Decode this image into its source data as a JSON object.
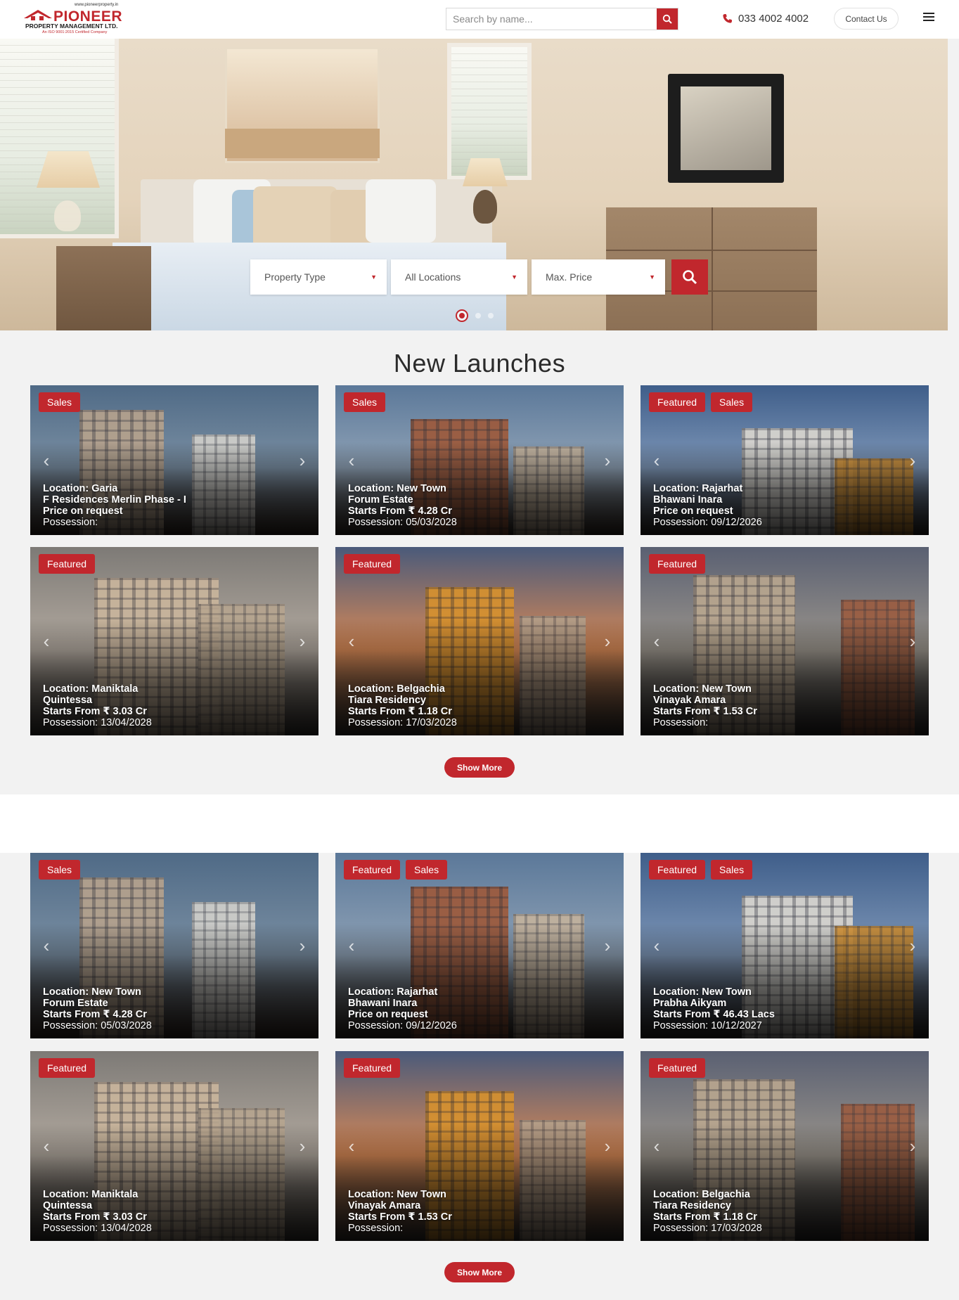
{
  "header": {
    "logo": {
      "url": "www.pioneerproperty.in",
      "name": "PIONEER",
      "subtitle": "PROPERTY MANAGEMENT LTD.",
      "iso": "An ISO 9001:2015 Certified Company"
    },
    "search": {
      "placeholder": "Search by name..."
    },
    "phone": "033 4002 4002",
    "contact_label": "Contact Us"
  },
  "hero": {
    "filters": {
      "property_type": "Property Type",
      "location": "All Locations",
      "max_price": "Max. Price"
    }
  },
  "new_launches": {
    "title": "New Launches",
    "show_more": "Show More",
    "cards": [
      {
        "tags": [
          "Sales"
        ],
        "location": "Location: Garia",
        "name": "F Residences Merlin Phase - I",
        "price": "Price on request",
        "possession": "Possession:"
      },
      {
        "tags": [
          "Sales"
        ],
        "location": "Location: New Town",
        "name": "Forum Estate",
        "price": "Starts From ₹ 4.28 Cr",
        "possession": "Possession: 05/03/2028"
      },
      {
        "tags": [
          "Featured",
          "Sales"
        ],
        "location": "Location: Rajarhat",
        "name": "Bhawani Inara",
        "price": "Price on request",
        "possession": "Possession: 09/12/2026"
      },
      {
        "tags": [
          "Featured"
        ],
        "location": "Location: Maniktala",
        "name": "Quintessa",
        "price": "Starts From ₹ 3.03 Cr",
        "possession": "Possession: 13/04/2028"
      },
      {
        "tags": [
          "Featured"
        ],
        "location": "Location: Belgachia",
        "name": "Tiara Residency",
        "price": "Starts From ₹ 1.18 Cr",
        "possession": "Possession: 17/03/2028"
      },
      {
        "tags": [
          "Featured"
        ],
        "location": "Location: New Town",
        "name": "Vinayak Amara",
        "price": "Starts From ₹ 1.53 Cr",
        "possession": "Possession:"
      }
    ]
  },
  "more_projects": {
    "show_more": "Show More",
    "cards": [
      {
        "tags": [
          "Sales"
        ],
        "location": "Location: New Town",
        "name": "Forum Estate",
        "price": "Starts From ₹ 4.28 Cr",
        "possession": "Possession: 05/03/2028"
      },
      {
        "tags": [
          "Featured",
          "Sales"
        ],
        "location": "Location: Rajarhat",
        "name": "Bhawani Inara",
        "price": "Price on request",
        "possession": "Possession: 09/12/2026"
      },
      {
        "tags": [
          "Featured",
          "Sales"
        ],
        "location": "Location: New Town",
        "name": "Prabha Aikyam",
        "price": "Starts From ₹ 46.43 Lacs",
        "possession": "Possession: 10/12/2027"
      },
      {
        "tags": [
          "Featured"
        ],
        "location": "Location: Maniktala",
        "name": "Quintessa",
        "price": "Starts From ₹ 3.03 Cr",
        "possession": "Possession: 13/04/2028"
      },
      {
        "tags": [
          "Featured"
        ],
        "location": "Location: New Town",
        "name": "Vinayak Amara",
        "price": "Starts From ₹ 1.53 Cr",
        "possession": "Possession:"
      },
      {
        "tags": [
          "Featured"
        ],
        "location": "Location: Belgachia",
        "name": "Tiara Residency",
        "price": "Starts From ₹ 1.18 Cr",
        "possession": "Possession: 17/03/2028"
      }
    ]
  },
  "colors": {
    "brand_red": "#c1272d",
    "section_bg": "#f2f2f2"
  },
  "icons": [
    "search-icon",
    "phone-icon",
    "menu-icon",
    "chevron-down-icon",
    "chevron-left-icon",
    "chevron-right-icon"
  ]
}
